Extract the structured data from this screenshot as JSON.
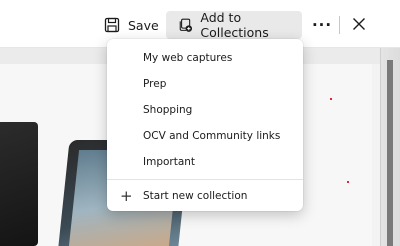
{
  "toolbar": {
    "save_label": "Save",
    "save_icon": "save-icon",
    "collections_label": "Add to Collections",
    "collections_icon": "collections-add-icon",
    "more_label": "···",
    "close_icon": "close-icon"
  },
  "menu": {
    "items": [
      {
        "label": "My web captures"
      },
      {
        "label": "Prep"
      },
      {
        "label": "Shopping"
      },
      {
        "label": "OCV and Community links"
      },
      {
        "label": "Important"
      }
    ],
    "start_new": {
      "icon": "+",
      "label": "Start new collection"
    }
  }
}
